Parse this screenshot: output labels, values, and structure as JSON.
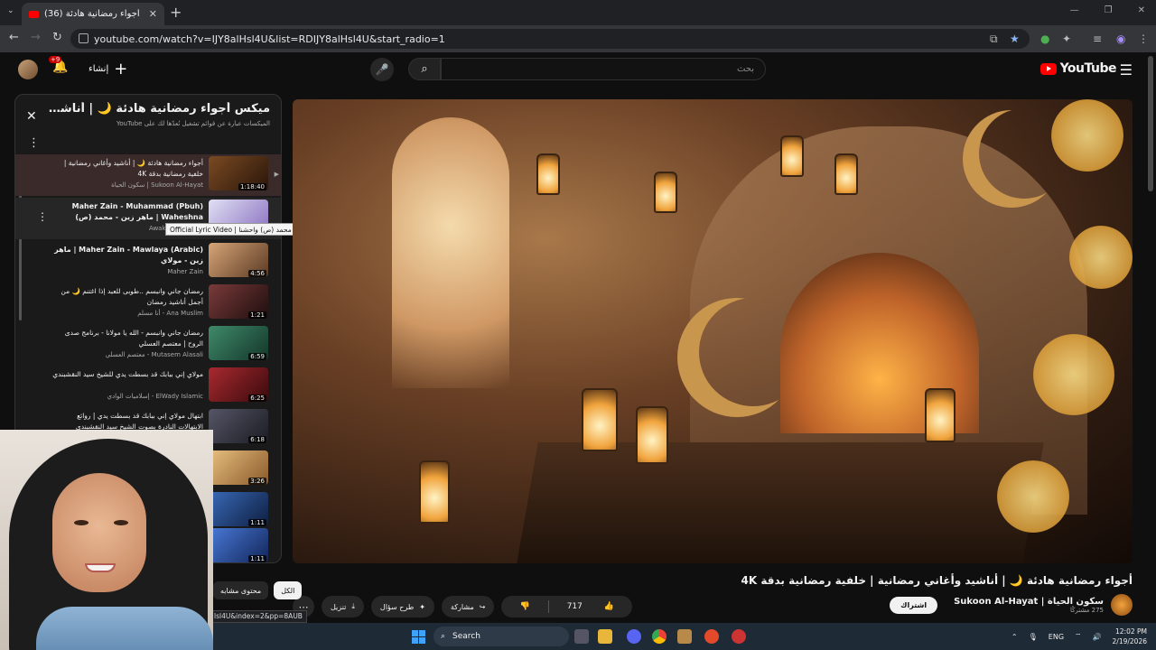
{
  "browser": {
    "tab_title": "(36) أجواء رمضانية هادئة 🌙",
    "url": "youtube.com/watch?v=IJY8alHsl4U&list=RDIJY8alHsl4U&start_radio=1"
  },
  "header": {
    "logo_text": "YouTube",
    "search_placeholder": "بحث",
    "create_label": "إنشاء",
    "notif_count": "+9",
    "search_icon": "search-icon",
    "mic_icon": "mic-icon"
  },
  "playlist": {
    "title": "ميكس أجواء رمضانية هادئة 🌙 | أناشيد وأغاني رمضانية | خلفية رمضانية",
    "subtitle": "الميكسات عبارة عن قوائم تشغيل نُعدّها لك على YouTube",
    "items": [
      {
        "title": "أجواء رمضانية هادئة 🌙 | أناشيد وأغاني رمضانية | خلفية رمضانية بدقة 4K",
        "channel": "Sukoon Al-Hayat | سكون الحياة",
        "duration": "1:18:40",
        "thumb": "#5a3316"
      },
      {
        "title": "Maher Zain - Muhammad (Pbuh) Waheshna | ماهر زين - محمد (ص) واحشنا",
        "channel": "Awakening Music",
        "duration": "",
        "thumb": "#c8c8e8"
      },
      {
        "title": "Maher Zain - Mawlaya (Arabic) | ماهر زين - مولاي",
        "channel": "Maher Zain",
        "duration": "4:56",
        "thumb": "#b37a4d"
      },
      {
        "title": "رمضان جاني وانبسم ..طوبى للعبد إذا اغتنم 🌙 من أجمل أناشيد رمضان",
        "channel": "Ana Muslim - أنا مسلم",
        "duration": "1:21",
        "thumb": "#5a2c2c"
      },
      {
        "title": "رمضان جاني وانبسم - الله يا مولانا - برنامج صدى الروح | معتصم العسلي",
        "channel": "Mutasem Alasali - معتصم العسلي",
        "duration": "6:59",
        "thumb": "#2d5f4a"
      },
      {
        "title": "مولاي إني ببابك قد بسطت يدي للشيخ سيد النقشبندي",
        "channel": "ElWady Islamic - إسلاميات الوادي",
        "duration": "6:25",
        "thumb": "#7a1e22"
      },
      {
        "title": "ابتهال مولاي إني ببابك قد بسطت يدي | روائع الابتهالات النادرة بصوت الشيخ سيد النقشبندي",
        "channel": "",
        "duration": "6:18",
        "thumb": "#3a3a4a"
      },
      {
        "title": "",
        "channel": "",
        "duration": "3:26",
        "thumb": "#d0a060"
      },
      {
        "title": "",
        "channel": "",
        "duration": "1:11",
        "thumb": "#1e3f7a"
      },
      {
        "title": "",
        "channel": "",
        "duration": "1:11",
        "thumb": "#2a4f9a"
      }
    ]
  },
  "tooltip": "Official Lyric Video | ماهر زين - محمد (ص) واحشنا | Maher Zain - Muhammad (Pbuh) Waheshna",
  "video": {
    "title": "أجواء رمضانية هادئة 🌙 | أناشيد وأغاني رمضانية | خلفية رمضانية بدقة 4K",
    "channel_name": "سكون الحياة | Sukoon Al-Hayat",
    "subscribers": "275 مشتركًا",
    "subscribe_label": "اشتراك",
    "likes": "717",
    "share_label": "مشاركة",
    "ask_label": "طرح سؤال",
    "download_label": "تنزيل"
  },
  "chips": {
    "all": "الكل",
    "related": "محتوى مشابه"
  },
  "status_url": "lsl4U&index=2&pp=8AUB",
  "taskbar": {
    "search_label": "Search",
    "lang": "ENG",
    "time": "12:02 PM",
    "date": "2/19/2026"
  }
}
